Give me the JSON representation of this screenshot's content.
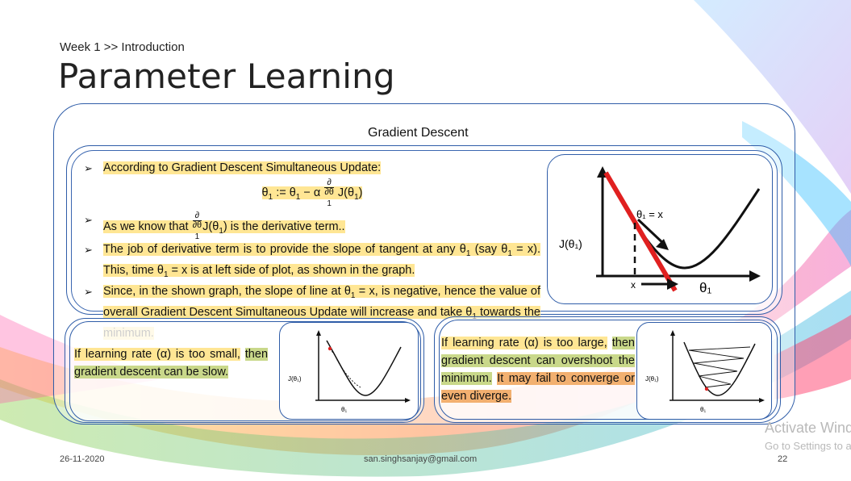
{
  "breadcrumb": "Week 1 >> Introduction",
  "title": "Parameter Learning",
  "section_title": "Gradient Descent",
  "bullets": {
    "b1": "According to Gradient Descent Simultaneous Update:",
    "formula_lhs": "θ",
    "formula_sub": "1",
    "formula_mid": ":= θ",
    "formula_mid_sub": "1",
    "formula_alpha": "− α",
    "frac_num": "∂",
    "frac_den": "∂θ",
    "frac_den_sub": "1",
    "formula_rhs": "J(θ",
    "formula_rhs_sub": "1",
    "formula_close": ")",
    "b2_pre": "As we know that",
    "b2_post_a": "J(θ",
    "b2_post_sub": "1",
    "b2_post_b": ") is the derivative term..",
    "b3_a": "The job of derivative term is to provide the slope of tangent at any θ",
    "b3_sub1": "1",
    "b3_b": "(say θ",
    "b3_sub2": "1",
    "b3_c": "= x). This, time θ",
    "b3_sub3": "1",
    "b3_d": "= x is at left side of plot, as shown in the graph.",
    "b4_a": "Since, in the shown graph, the slope of line at θ",
    "b4_sub1": "1",
    "b4_b": "= x, is negative, hence the value of overall Gradient Descent Simultaneous Update will increase and take θ",
    "b4_sub2": "1",
    "b4_c": "towards the minimum."
  },
  "main_graph": {
    "ylabel": "J(θ₁)",
    "xlabel": "θ₁",
    "point_label": "θ₁ = x",
    "x_marker": "x"
  },
  "small_lr": {
    "text_a": "If learning rate (α) is too small,",
    "text_b": "then gradient descent can be slow.",
    "ylabel": "J(θ₁)",
    "xlabel": "θ₁"
  },
  "large_lr": {
    "text_a": "If learning rate (α) is too large,",
    "text_b": "then gradient descent can overshoot the minimum.",
    "text_c": "It may fail to converge or even diverge.",
    "ylabel": "J(θ₁)",
    "xlabel": "θ₁"
  },
  "footer": {
    "date": "26-11-2020",
    "email": "san.singhsanjay@gmail.com",
    "page": "22"
  },
  "watermark": {
    "line1": "Activate Windows",
    "line2": "Go to Settings to activate Windows."
  },
  "colors": {
    "frame": "#2f5da8",
    "highlight_yellow": "#ffe694",
    "highlight_green": "#c9d88a",
    "highlight_orange": "#f2b070",
    "tangent_red": "#e02020"
  }
}
